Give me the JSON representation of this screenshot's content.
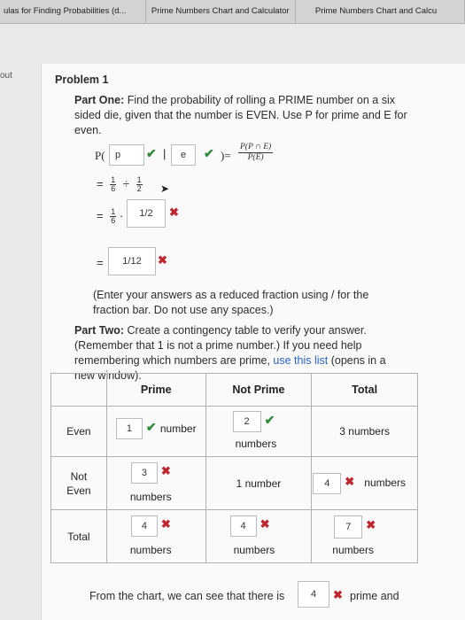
{
  "tabs": [
    "ulas for Finding Probabilities (d...",
    "Prime Numbers Chart and Calculator",
    "Prime Numbers Chart and Calcu"
  ],
  "left_nav": "out",
  "problem": {
    "title": "Problem 1",
    "part_one_label": "Part One:",
    "part_one_text": " Find the probability of rolling a PRIME number on a six sided die, given that the number is EVEN. Use P for prime and E for even.",
    "P_open": "P(",
    "bar": "|",
    "close_eq": ")=",
    "formula_num": "P(P ∩ E)",
    "formula_den": "P(E)",
    "input_p": "p",
    "input_e": "e",
    "eq": "=",
    "frac1_n": "1",
    "frac1_d": "6",
    "div": "÷",
    "frac2_n": "1",
    "frac2_d": "2",
    "frac3_n": "1",
    "frac3_d": "6",
    "dot": "·",
    "input_half": "1/2",
    "input_result": "1/12",
    "instruction": "(Enter your answers as a reduced fraction using / for the fraction bar. Do not use any spaces.)",
    "part_two_label": "Part Two:",
    "part_two_text": " Create a contingency table to verify your answer. (Remember that 1 is not a prime number.) If you need help remembering which numbers are prime, ",
    "part_two_link": "use this list",
    "part_two_end": " (opens in a new window).",
    "footer_pre": "From the chart, we can see that there is",
    "footer_input": "4",
    "footer_post": "prime and"
  },
  "table": {
    "headers": [
      "",
      "Prime",
      "Not Prime",
      "Total"
    ],
    "rows": [
      {
        "label": "Even",
        "prime_input": "1",
        "prime_unit": "number",
        "notprime_input": "2",
        "notprime_unit": "numbers",
        "total_text": "3 numbers"
      },
      {
        "label": "Not Even",
        "prime_input": "3",
        "prime_unit": "numbers",
        "notprime_text": "1 number",
        "total_input": "4",
        "total_unit": "numbers"
      },
      {
        "label": "Total",
        "prime_input": "4",
        "prime_unit": "numbers",
        "notprime_input": "4",
        "notprime_unit": "numbers",
        "total_input": "7",
        "total_unit": "numbers"
      }
    ]
  },
  "icons": {
    "correct": "check-icon",
    "incorrect": "x-icon"
  },
  "colors": {
    "correct": "#2e8b3a",
    "incorrect": "#c0262d",
    "link": "#2a66c9"
  }
}
